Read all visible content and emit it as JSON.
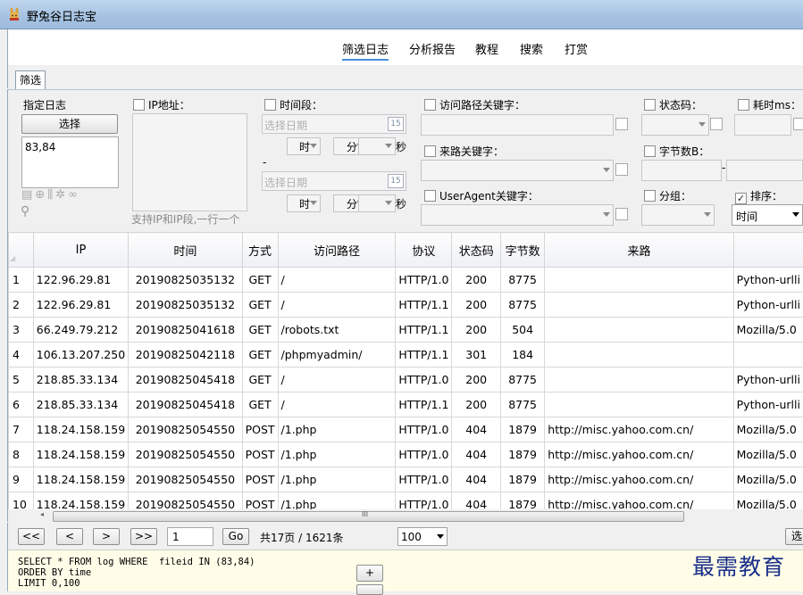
{
  "window": {
    "title": "野兔谷日志宝"
  },
  "menu": [
    "筛选日志",
    "分析报告",
    "教程",
    "搜索",
    "打赏"
  ],
  "tab": "筛选",
  "filters": {
    "log": {
      "label": "指定日志",
      "button": "选择",
      "value": "83,84"
    },
    "ip": {
      "label": "IP地址：",
      "hint": "支持IP和IP段,一行一个"
    },
    "time": {
      "label": "时间段：",
      "date_placeholder": "选择日期",
      "hour": "时",
      "minute": "分",
      "second": "秒",
      "dash": "-",
      "cal": "15"
    },
    "path": {
      "label": "访问路径关键字："
    },
    "referer": {
      "label": "来路关键字："
    },
    "useragent": {
      "label": "UserAgent关键字："
    },
    "status": {
      "label": "状态码："
    },
    "elapsed": {
      "label": "耗时ms："
    },
    "bytes": {
      "label": "字节数B：",
      "dash": "-"
    },
    "group": {
      "label": "分组："
    },
    "sort": {
      "label": "排序：",
      "value": "时间"
    }
  },
  "table": {
    "headers": [
      "IP",
      "时间",
      "方式",
      "访问路径",
      "协议",
      "状态码",
      "字节数",
      "来路",
      ""
    ],
    "rows": [
      [
        "1",
        "122.96.29.81",
        "20190825035132",
        "GET",
        "/",
        "HTTP/1.0",
        "200",
        "8775",
        "",
        "Python-urlli"
      ],
      [
        "2",
        "122.96.29.81",
        "20190825035132",
        "GET",
        "/",
        "HTTP/1.1",
        "200",
        "8775",
        "",
        "Python-urlli"
      ],
      [
        "3",
        "66.249.79.212",
        "20190825041618",
        "GET",
        "/robots.txt",
        "HTTP/1.1",
        "200",
        "504",
        "",
        "Mozilla/5.0"
      ],
      [
        "4",
        "106.13.207.250",
        "20190825042118",
        "GET",
        "/phpmyadmin/",
        "HTTP/1.1",
        "301",
        "184",
        "",
        ""
      ],
      [
        "5",
        "218.85.33.134",
        "20190825045418",
        "GET",
        "/",
        "HTTP/1.0",
        "200",
        "8775",
        "",
        "Python-urlli"
      ],
      [
        "6",
        "218.85.33.134",
        "20190825045418",
        "GET",
        "/",
        "HTTP/1.1",
        "200",
        "8775",
        "",
        "Python-urlli"
      ],
      [
        "7",
        "118.24.158.159",
        "20190825054550",
        "POST",
        "/1.php",
        "HTTP/1.0",
        "404",
        "1879",
        "http://misc.yahoo.com.cn/",
        "Mozilla/5.0"
      ],
      [
        "8",
        "118.24.158.159",
        "20190825054550",
        "POST",
        "/1.php",
        "HTTP/1.0",
        "404",
        "1879",
        "http://misc.yahoo.com.cn/",
        "Mozilla/5.0"
      ],
      [
        "9",
        "118.24.158.159",
        "20190825054550",
        "POST",
        "/1.php",
        "HTTP/1.0",
        "404",
        "1879",
        "http://misc.yahoo.com.cn/",
        "Mozilla/5.0"
      ],
      [
        "10",
        "118.24.158.159",
        "20190825054550",
        "POST",
        "/1.php",
        "HTTP/1.0",
        "404",
        "1879",
        "http://misc.yahoo.com.cn/",
        "Mozilla/5.0"
      ]
    ]
  },
  "scroll_grip": "III",
  "pager": {
    "first": "<<",
    "prev": "<",
    "next": ">",
    "last": ">>",
    "page": "1",
    "go": "Go",
    "summary": "共17页 / 1621条",
    "page_size": "100",
    "right_btn": "选"
  },
  "sql": "SELECT * FROM log WHERE  fileid IN (83,84)\nORDER BY time\nLIMIT 0,100",
  "plus": "+",
  "watermark": "最需教育"
}
